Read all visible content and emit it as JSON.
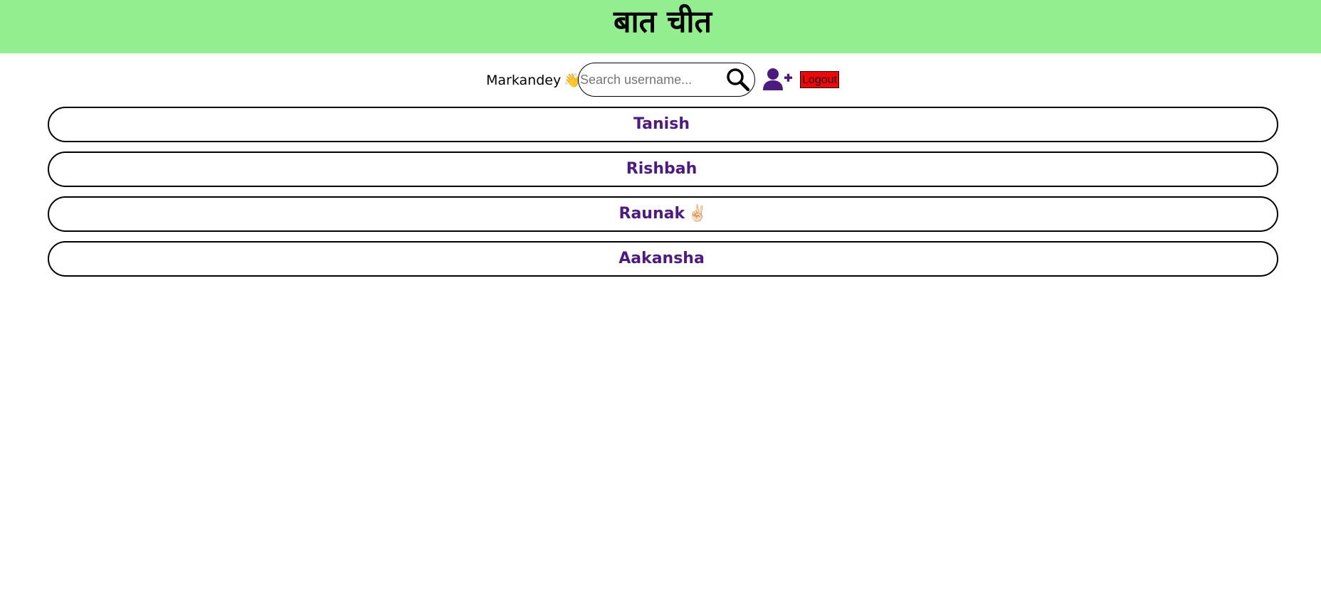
{
  "app": {
    "title": "बात चीत"
  },
  "toolbar": {
    "username": "Markandey",
    "greeting_emoji": "👋",
    "search_placeholder": "Search username...",
    "search_value": "",
    "search_icon": "search-icon",
    "add_user_icon": "add-user-icon",
    "logout_label": "Logout"
  },
  "contacts": [
    {
      "name": "Tanish",
      "emoji": ""
    },
    {
      "name": "Rishbah",
      "emoji": ""
    },
    {
      "name": "Raunak",
      "emoji": "✌🏻"
    },
    {
      "name": "Aakansha",
      "emoji": ""
    }
  ],
  "colors": {
    "header_bg": "#93ee90",
    "contact_name": "#4d1a7f",
    "add_user_icon": "#4d1a7f",
    "logout_bg": "#ff0000"
  }
}
